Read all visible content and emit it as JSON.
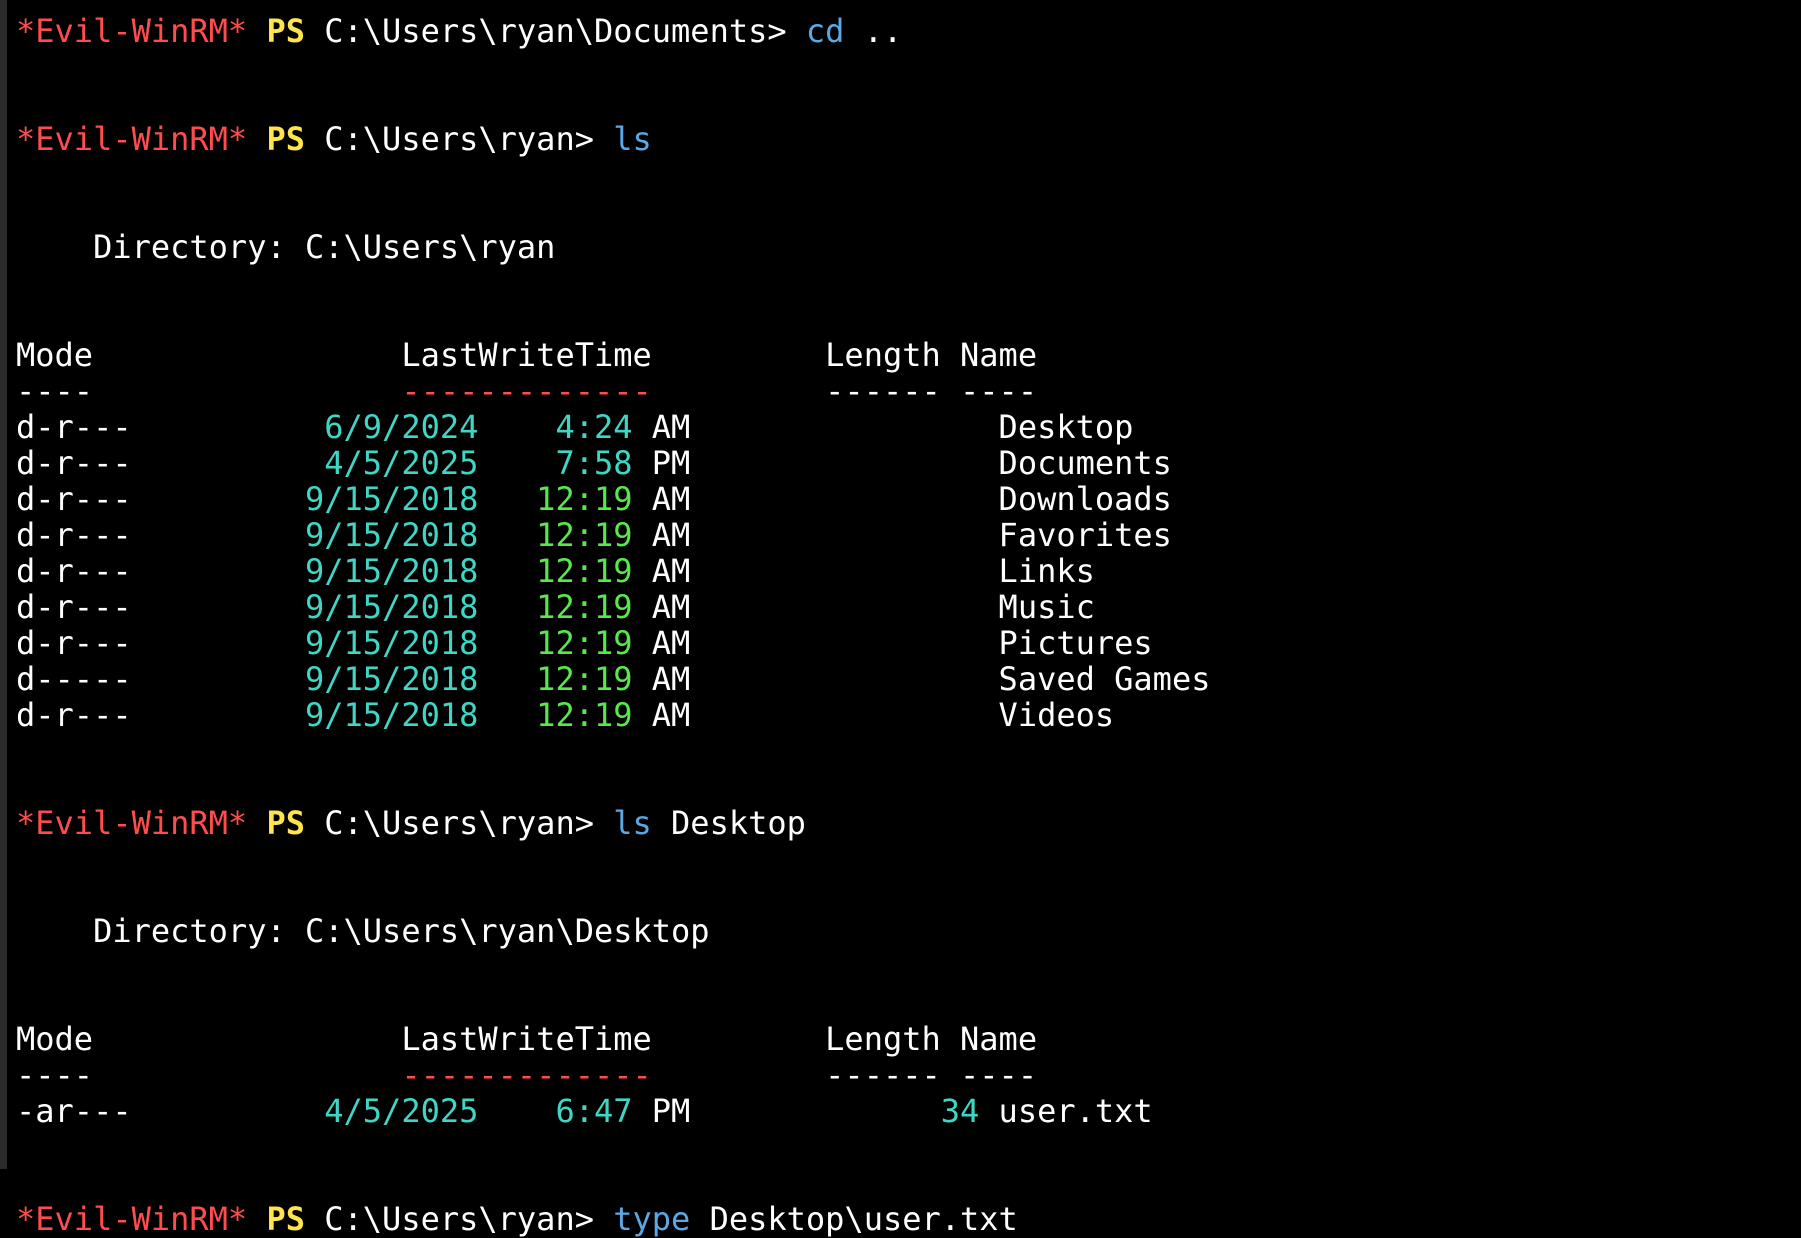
{
  "prompt": {
    "tag": "*Evil-WinRM*",
    "ps": "PS"
  },
  "session": [
    {
      "kind": "prompt",
      "path": "C:\\Users\\ryan\\Documents>",
      "cmd": "cd",
      "arg": ".."
    },
    {
      "kind": "prompt",
      "path": "C:\\Users\\ryan>",
      "cmd": "ls",
      "arg": ""
    },
    {
      "kind": "listing",
      "directory_label": "    Directory: C:\\Users\\ryan",
      "headers": {
        "mode": "Mode",
        "lastwrite": "LastWriteTime",
        "length": "Length",
        "name": "Name"
      },
      "underline": {
        "mode": "----",
        "lastwrite": "-------------",
        "length": "------",
        "name": "----"
      },
      "rows": [
        {
          "mode": "d-r---",
          "date": "6/9/2024",
          "time": "4:24",
          "ampm": "AM",
          "length": "",
          "name": "Desktop",
          "recent": true
        },
        {
          "mode": "d-r---",
          "date": "4/5/2025",
          "time": "7:58",
          "ampm": "PM",
          "length": "",
          "name": "Documents",
          "recent": true
        },
        {
          "mode": "d-r---",
          "date": "9/15/2018",
          "time": "12:19",
          "ampm": "AM",
          "length": "",
          "name": "Downloads",
          "recent": false
        },
        {
          "mode": "d-r---",
          "date": "9/15/2018",
          "time": "12:19",
          "ampm": "AM",
          "length": "",
          "name": "Favorites",
          "recent": false
        },
        {
          "mode": "d-r---",
          "date": "9/15/2018",
          "time": "12:19",
          "ampm": "AM",
          "length": "",
          "name": "Links",
          "recent": false
        },
        {
          "mode": "d-r---",
          "date": "9/15/2018",
          "time": "12:19",
          "ampm": "AM",
          "length": "",
          "name": "Music",
          "recent": false
        },
        {
          "mode": "d-r---",
          "date": "9/15/2018",
          "time": "12:19",
          "ampm": "AM",
          "length": "",
          "name": "Pictures",
          "recent": false
        },
        {
          "mode": "d-----",
          "date": "9/15/2018",
          "time": "12:19",
          "ampm": "AM",
          "length": "",
          "name": "Saved Games",
          "recent": false
        },
        {
          "mode": "d-r---",
          "date": "9/15/2018",
          "time": "12:19",
          "ampm": "AM",
          "length": "",
          "name": "Videos",
          "recent": false
        }
      ]
    },
    {
      "kind": "prompt",
      "path": "C:\\Users\\ryan>",
      "cmd": "ls",
      "arg": "Desktop"
    },
    {
      "kind": "listing",
      "directory_label": "    Directory: C:\\Users\\ryan\\Desktop",
      "headers": {
        "mode": "Mode",
        "lastwrite": "LastWriteTime",
        "length": "Length",
        "name": "Name"
      },
      "underline": {
        "mode": "----",
        "lastwrite": "-------------",
        "length": "------",
        "name": "----"
      },
      "rows": [
        {
          "mode": "-ar---",
          "date": "4/5/2025",
          "time": "6:47",
          "ampm": "PM",
          "length": "34",
          "name": "user.txt",
          "recent": true
        }
      ]
    },
    {
      "kind": "prompt",
      "path": "C:\\Users\\ryan>",
      "cmd": "type",
      "arg": "Desktop\\user.txt"
    }
  ],
  "colors": {
    "background": "#000000",
    "evil_tag": "#ff4d4d",
    "ps_label": "#ffe44d",
    "command": "#5aa9e6",
    "date": "#3fd6c5",
    "old_time": "#57e84a"
  }
}
